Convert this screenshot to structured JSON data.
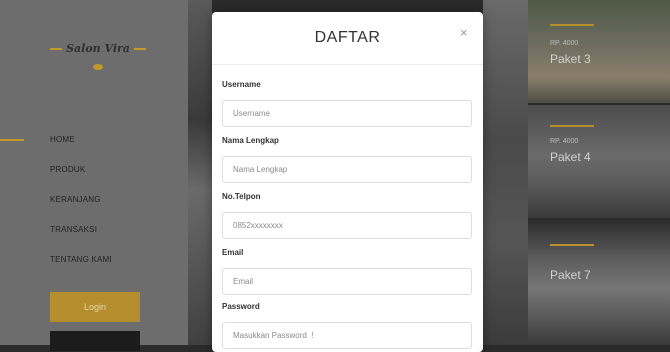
{
  "sidebar": {
    "brand": "Salon Vira",
    "nav": [
      {
        "label": "HOME"
      },
      {
        "label": "PRODUK"
      },
      {
        "label": "KERANJANG"
      },
      {
        "label": "TRANSAKSI"
      },
      {
        "label": "TENTANG KAMI"
      }
    ],
    "login_label": "Login"
  },
  "cards": [
    {
      "price": "RP. 4000",
      "title": "Paket 3"
    },
    {
      "price": "RP. 4000",
      "title": "Paket 4"
    },
    {
      "price": "",
      "title": "Paket 7"
    }
  ],
  "modal": {
    "title": "DAFTAR",
    "close": "×",
    "fields": [
      {
        "label": "Username",
        "placeholder": "Username"
      },
      {
        "label": "Nama Lengkap",
        "placeholder": "Nama Lengkap"
      },
      {
        "label": "No.Telpon",
        "placeholder": "0852xxxxxxxx"
      },
      {
        "label": "Email",
        "placeholder": "Email"
      },
      {
        "label": "Password",
        "placeholder": "Masukkan Password  !"
      }
    ]
  }
}
